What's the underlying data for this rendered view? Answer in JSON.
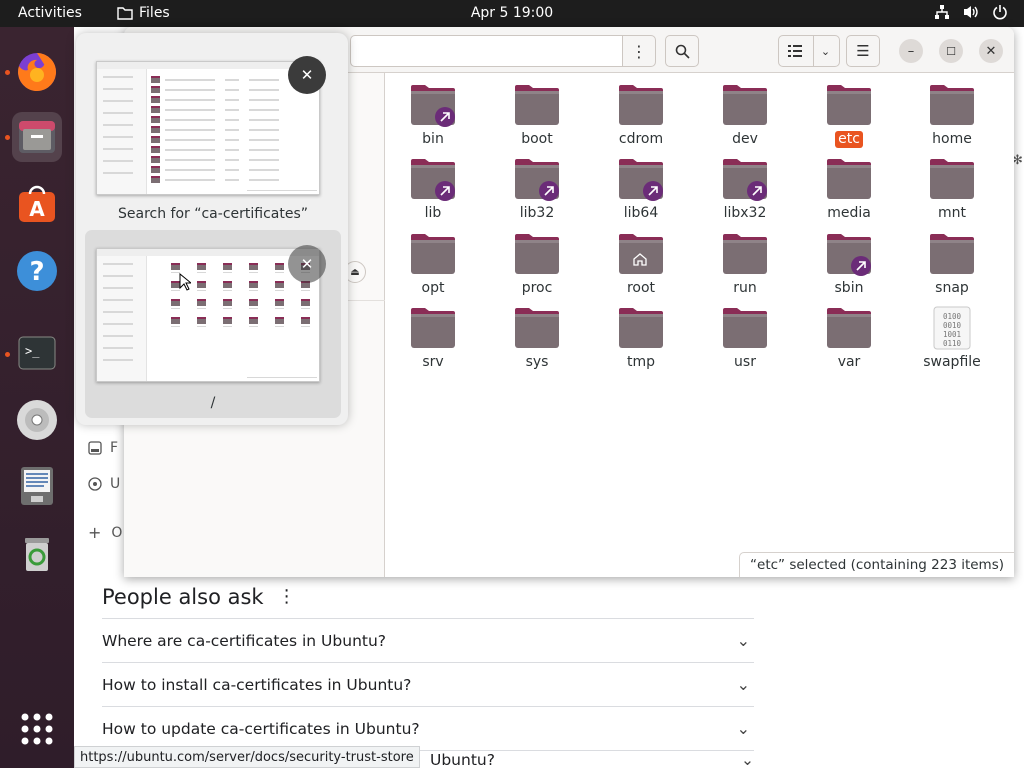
{
  "topbar": {
    "activities": "Activities",
    "app_name": "Files",
    "clock": "Apr 5  19:00",
    "tray_icons": [
      "network-icon",
      "volume-icon",
      "power-icon"
    ]
  },
  "dock": {
    "items": [
      "firefox-icon",
      "files-icon",
      "software-icon",
      "help-icon",
      "terminal-icon",
      "disc-icon",
      "text-editor-icon",
      "trash-icon",
      "app-grid-icon"
    ],
    "accent": "#e95420"
  },
  "switcher": {
    "items": [
      {
        "title": "Search for “ca-certificates”"
      },
      {
        "title": "/"
      }
    ]
  },
  "files": {
    "items": [
      {
        "name": "bin",
        "link": true
      },
      {
        "name": "boot"
      },
      {
        "name": "cdrom"
      },
      {
        "name": "dev"
      },
      {
        "name": "etc",
        "selected": true
      },
      {
        "name": "home"
      },
      {
        "name": "lib",
        "link": true
      },
      {
        "name": "lib32",
        "link": true
      },
      {
        "name": "lib64",
        "link": true
      },
      {
        "name": "libx32",
        "link": true
      },
      {
        "name": "media"
      },
      {
        "name": "mnt"
      },
      {
        "name": "opt"
      },
      {
        "name": "proc"
      },
      {
        "name": "root",
        "home_icon": true
      },
      {
        "name": "run"
      },
      {
        "name": "sbin",
        "link": true
      },
      {
        "name": "snap"
      },
      {
        "name": "srv"
      },
      {
        "name": "sys"
      },
      {
        "name": "tmp"
      },
      {
        "name": "usr"
      },
      {
        "name": "var"
      },
      {
        "name": "swapfile",
        "file": true
      }
    ],
    "status": "“etc” selected  (containing 223 items)",
    "sidebar_peek": [
      "F",
      "U",
      "O"
    ],
    "folder_color": "#7b6e73",
    "folder_tab_color": "#8a2d56",
    "link_badge_color": "#6b2c78"
  },
  "browser": {
    "paa_title": "People also ask",
    "questions": [
      "Where are ca-certificates in Ubuntu?",
      "How to install ca-certificates in Ubuntu?",
      "How to update ca-certificates in Ubuntu?"
    ],
    "partial_question": "Ubuntu?",
    "status_url": "https://ubuntu.com/server/docs/security-trust-store"
  }
}
